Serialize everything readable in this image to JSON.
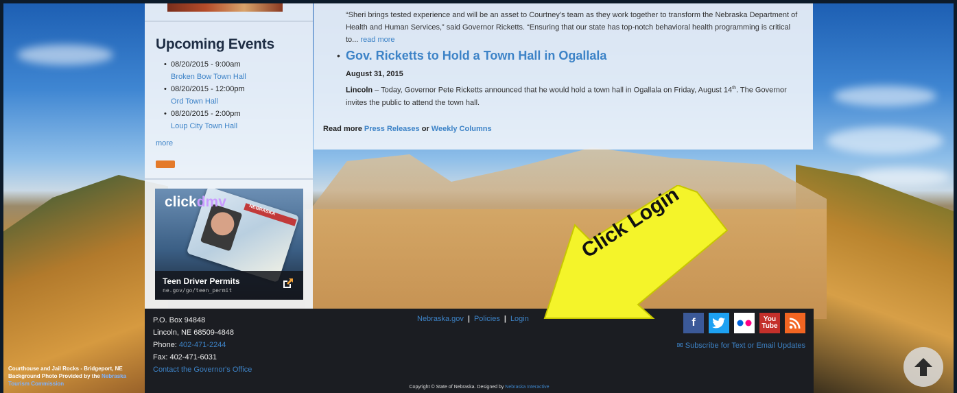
{
  "events": {
    "title": "Upcoming Events",
    "items": [
      {
        "datetime": "08/20/2015 - 9:00am",
        "name": "Broken Bow Town Hall"
      },
      {
        "datetime": "08/20/2015 - 12:00pm",
        "name": "Ord Town Hall"
      },
      {
        "datetime": "08/20/2015 - 2:00pm",
        "name": "Loup City Town Hall"
      }
    ],
    "more": "more"
  },
  "clickdmv": {
    "logo_a": "click",
    "logo_b": "dmv",
    "card_label": "NEBRASKA",
    "title": "Teen Driver Permits",
    "url": "ne.gov/go/teen_permit"
  },
  "news": {
    "quote": "“Sheri brings tested experience and will be an asset to Courtney’s team as they work together to transform the Nebraska Department of Health and Human Services,” said Governor Ricketts. “Ensuring that our state has top-notch behavioral health programming is critical to...",
    "quote_link": "read more",
    "headline": "Gov. Ricketts to Hold a Town Hall in Ogallala",
    "date": "August 31, 2015",
    "body_place": "Lincoln",
    "body_text": " – Today, Governor Pete Ricketts announced that he would hold a town hall in Ogallala on Friday, August 14",
    "body_sup": "th",
    "body_tail": ".  The Governor invites the public to attend the town hall.",
    "read_more_prefix": "Read more ",
    "press_releases": "Press Releases",
    "or": " or ",
    "weekly_columns": "Weekly Columns"
  },
  "footer": {
    "po_box": "P.O. Box 94848",
    "city": "Lincoln, NE 68509-4848",
    "phone_label": "Phone: ",
    "phone": "402-471-2244",
    "fax": "Fax: 402-471-6031",
    "contact": "Contact the Governor's Office",
    "links": {
      "nebraska": "Nebraska.gov",
      "policies": "Policies",
      "login": "Login",
      "sep": "|"
    },
    "subscribe": "Subscribe for Text or Email Updates",
    "copyright_text": "Copyright © State of Nebraska. Designed by ",
    "copyright_link": "Nebraska Interactive"
  },
  "credit": {
    "line": "Courthouse and Jail Rocks - Bridgeport, NE Background Photo Provided by the",
    "link": "Nebraska Tourism Commission"
  },
  "annotation": {
    "text": "Click Login",
    "color": "#f4f42a"
  },
  "icons": {
    "facebook": "f",
    "youtube": "You Tube"
  }
}
